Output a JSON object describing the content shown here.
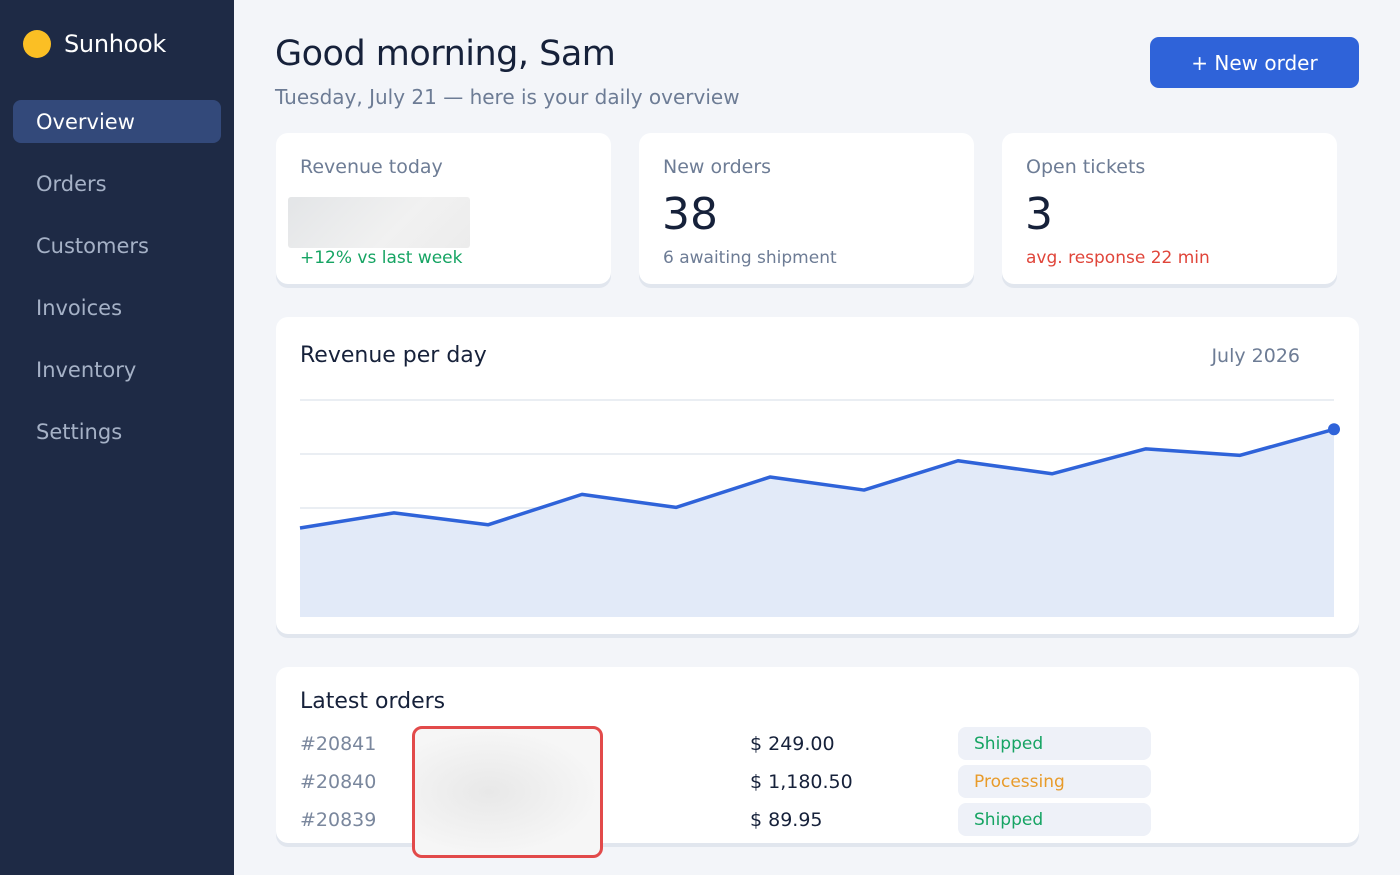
{
  "app": {
    "name": "Sunhook",
    "colors": {
      "sidebar": "#1e2a45",
      "accent": "#2f63d9",
      "brand_dot": "#fbbf24",
      "positive": "#16a463",
      "negative": "#e0453a",
      "warning": "#e89b2a"
    }
  },
  "sidebar": {
    "items": [
      {
        "label": "Overview",
        "active": true
      },
      {
        "label": "Orders",
        "active": false
      },
      {
        "label": "Customers",
        "active": false
      },
      {
        "label": "Invoices",
        "active": false
      },
      {
        "label": "Inventory",
        "active": false
      },
      {
        "label": "Settings",
        "active": false
      }
    ]
  },
  "header": {
    "greeting": "Good morning, Sam",
    "subline": "Tuesday, July 21 — here is your daily overview",
    "new_order_label": "+ New order"
  },
  "stats": [
    {
      "label": "Revenue today",
      "value": "",
      "sub": "+12% vs last week",
      "tone": "positive"
    },
    {
      "label": "New orders",
      "value": "38",
      "sub": "6 awaiting shipment",
      "tone": "neutral"
    },
    {
      "label": "Open tickets",
      "value": "3",
      "sub": "avg. response 22 min",
      "tone": "negative"
    }
  ],
  "chart": {
    "title": "Revenue per day",
    "period": "July 2026"
  },
  "chart_data": {
    "type": "area",
    "title": "Revenue per day",
    "period": "July 2026",
    "values": [
      0.41,
      0.48,
      0.425,
      0.565,
      0.505,
      0.645,
      0.585,
      0.72,
      0.66,
      0.775,
      0.745,
      0.865
    ],
    "ylim": [
      0,
      1
    ],
    "grid": true,
    "line_color": "#2f63d9",
    "fill_color": "#e2eaf8",
    "last_point_marker": true
  },
  "orders": {
    "title": "Latest orders",
    "rows": [
      {
        "id": "#20841",
        "amount": "$ 249.00",
        "status": "Shipped"
      },
      {
        "id": "#20840",
        "amount": "$ 1,180.50",
        "status": "Processing"
      },
      {
        "id": "#20839",
        "amount": "$ 89.95",
        "status": "Shipped"
      }
    ]
  }
}
